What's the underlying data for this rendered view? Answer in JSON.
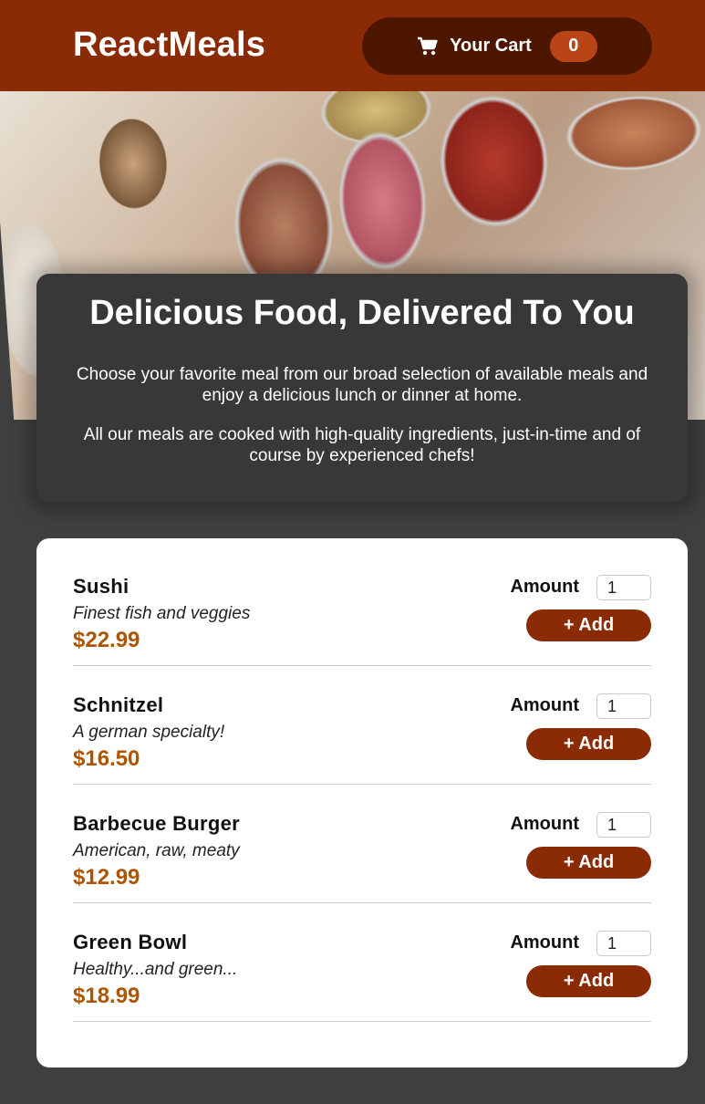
{
  "header": {
    "brand": "ReactMeals",
    "cart": {
      "icon": "cart-icon",
      "label": "Your Cart",
      "count": "0"
    }
  },
  "hero": {
    "image": "food-buffet-photo"
  },
  "summary": {
    "title": "Delicious Food, Delivered To You",
    "paragraphs": [
      "Choose your favorite meal from our broad selection of available meals and enjoy a delicious lunch or dinner at home.",
      "All our meals are cooked with high-quality ingredients, just-in-time and of course by experienced chefs!"
    ]
  },
  "meals": [
    {
      "name": "Sushi",
      "description": "Finest fish and veggies",
      "price": "$22.99",
      "amount_label": "Amount",
      "amount": "1",
      "add_label": "+ Add"
    },
    {
      "name": "Schnitzel",
      "description": "A german specialty!",
      "price": "$16.50",
      "amount_label": "Amount",
      "amount": "1",
      "add_label": "+ Add"
    },
    {
      "name": "Barbecue Burger",
      "description": "American, raw, meaty",
      "price": "$12.99",
      "amount_label": "Amount",
      "amount": "1",
      "add_label": "+ Add"
    },
    {
      "name": "Green Bowl",
      "description": "Healthy...and green...",
      "price": "$18.99",
      "amount_label": "Amount",
      "amount": "1",
      "add_label": "+ Add"
    }
  ],
  "colors": {
    "header": "#8a2b06",
    "cart_button": "#4d1601",
    "badge": "#b94517",
    "price": "#ad5502",
    "background": "#3f3f3f",
    "summary_card": "#383838"
  }
}
